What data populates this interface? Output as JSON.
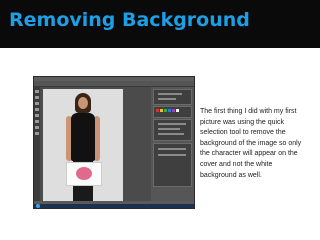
{
  "slide": {
    "title": "Removing Background",
    "body": "The first thing I did with my first picture was using the quick selection tool to remove the background of the image so only the character will appear on the cover and not the white background as well."
  },
  "colors": {
    "title_bar": "#0a0a0a",
    "title_text": "#1d9fe6",
    "photoshop_ui": "#4b4b4b",
    "canvas": "#dedede"
  },
  "screenshot": {
    "app": "photoshop-workspace",
    "icons": [
      "toolbox-icon",
      "layers-panel-icon",
      "color-swatches-icon",
      "windows-start-icon"
    ]
  }
}
